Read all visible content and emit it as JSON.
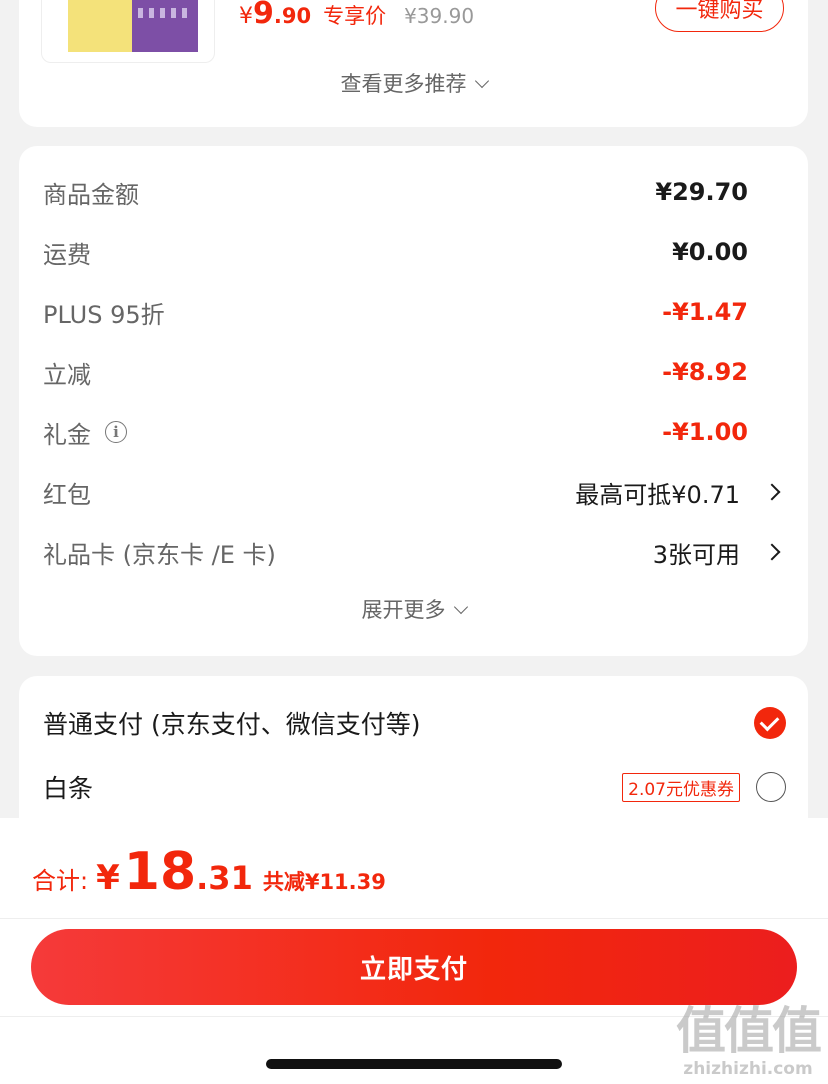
{
  "recommend": {
    "currency": "¥",
    "price_int": "9",
    "price_dec": ".90",
    "exclusive_label": "专享价",
    "original_price": "¥39.90",
    "buy_label": "一键购买",
    "more_label": "查看更多推荐"
  },
  "summary": {
    "rows": [
      {
        "label": "商品金额",
        "value": "¥29.70"
      },
      {
        "label": "运费",
        "value": "¥0.00"
      },
      {
        "label": "PLUS 95折",
        "value": "-¥1.47"
      },
      {
        "label": "立减",
        "value": "-¥8.92"
      },
      {
        "label": "礼金",
        "value": "-¥1.00"
      },
      {
        "label": "红包",
        "value": "最高可抵¥0.71"
      },
      {
        "label": "礼品卡 (京东卡 /E 卡)",
        "value": "3张可用"
      }
    ],
    "expand_label": "展开更多",
    "accent_red": "#f2270c"
  },
  "payment": {
    "options": [
      {
        "label": "普通支付 (京东支付、微信支付等)",
        "selected": true
      },
      {
        "label": "白条",
        "coupon": "2.07元优惠券",
        "selected": false
      }
    ]
  },
  "footer": {
    "total_label": "合计:",
    "currency": "¥",
    "total_int": "18",
    "total_dec": ".31",
    "saved": "共减¥11.39",
    "pay_label": "立即支付",
    "watermark_big": "值值值",
    "watermark_small": "zhizhizhi.com"
  }
}
